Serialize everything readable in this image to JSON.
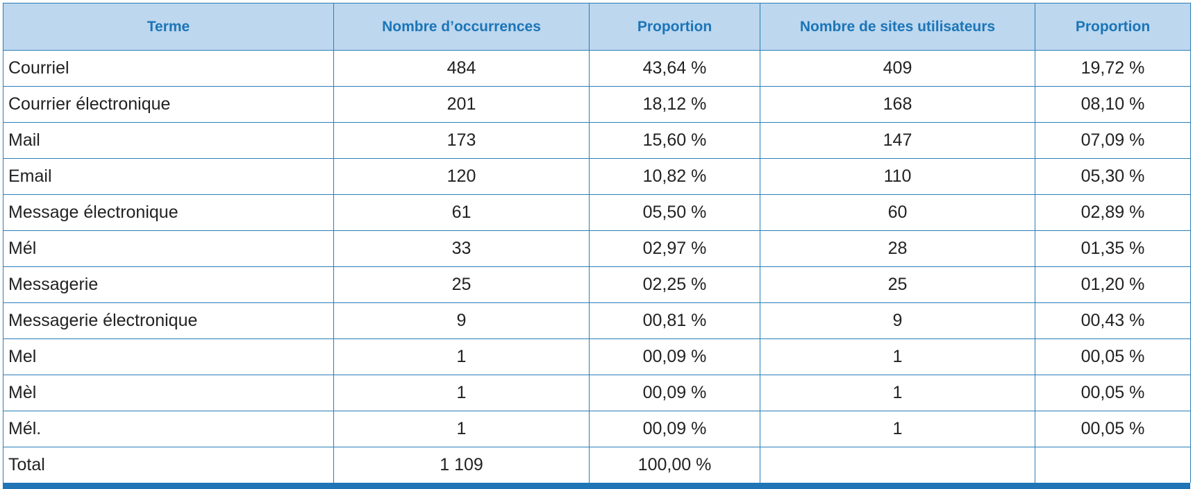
{
  "table": {
    "headers": [
      "Terme",
      "Nombre d’occurrences",
      "Proportion",
      "Nombre de sites utilisateurs",
      "Proportion"
    ],
    "rows": [
      [
        "Courriel",
        "484",
        "43,64 %",
        "409",
        "19,72 %"
      ],
      [
        "Courrier électronique",
        "201",
        "18,12 %",
        "168",
        "08,10 %"
      ],
      [
        "Mail",
        "173",
        "15,60 %",
        "147",
        "07,09 %"
      ],
      [
        "Email",
        "120",
        "10,82 %",
        "110",
        "05,30 %"
      ],
      [
        "Message électronique",
        "61",
        "05,50 %",
        "60",
        "02,89 %"
      ],
      [
        "Mél",
        "33",
        "02,97 %",
        "28",
        "01,35 %"
      ],
      [
        "Messagerie",
        "25",
        "02,25 %",
        "25",
        "01,20 %"
      ],
      [
        "Messagerie électronique",
        "9",
        "00,81 %",
        "9",
        "00,43 %"
      ],
      [
        "Mel",
        "1",
        "00,09 %",
        "1",
        "00,05 %"
      ],
      [
        "Mèl",
        "1",
        "00,09 %",
        "1",
        "00,05 %"
      ],
      [
        "Mél.",
        "1",
        "00,09 %",
        "1",
        "00,05 %"
      ]
    ],
    "total": [
      "Total",
      "1 109",
      "100,00 %",
      "",
      ""
    ]
  },
  "colors": {
    "header_bg": "#bdd7ee",
    "header_text": "#1b75b7",
    "border": "#2a7db8",
    "bottom_bar": "#1f75b5"
  }
}
